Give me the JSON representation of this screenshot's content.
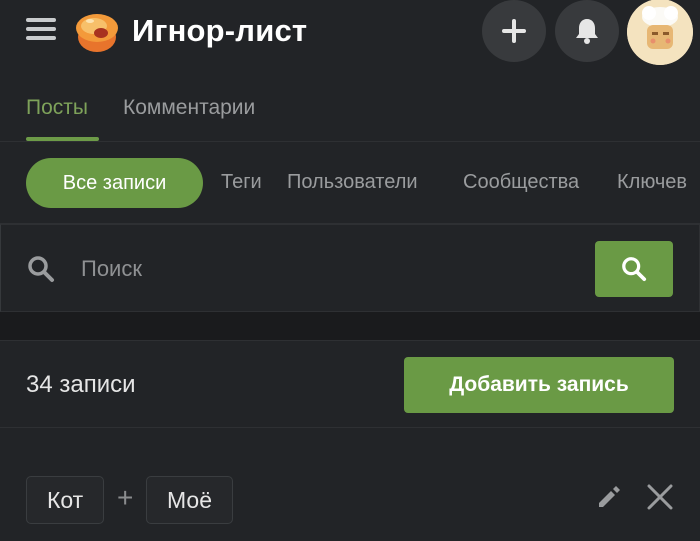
{
  "header": {
    "title": "Игнор-лист",
    "menu_icon": "hamburger-icon",
    "logo_icon": "pikabu-logo",
    "add_icon": "plus-icon",
    "notifications_icon": "bell-icon",
    "avatar_icon": "user-avatar"
  },
  "tabs": [
    {
      "label": "Посты",
      "active": true
    },
    {
      "label": "Комментарии",
      "active": false
    }
  ],
  "filters": [
    {
      "label": "Все записи",
      "active": true
    },
    {
      "label": "Теги",
      "active": false
    },
    {
      "label": "Пользователи",
      "active": false
    },
    {
      "label": "Сообщества",
      "active": false
    },
    {
      "label": "Ключев",
      "active": false
    }
  ],
  "search": {
    "placeholder": "Поиск",
    "value": "",
    "icon": "search-icon"
  },
  "records": {
    "count_label": "34 записи",
    "add_label": "Добавить запись"
  },
  "entries": [
    {
      "tags": [
        "Кот",
        "Моё"
      ],
      "joiner": "+",
      "edit_icon": "pencil-icon",
      "remove_icon": "close-icon"
    }
  ],
  "colors": {
    "accent": "#6a9a45",
    "accent_text": "#7ea25a",
    "background": "#1c1e20",
    "panel": "#222427"
  }
}
